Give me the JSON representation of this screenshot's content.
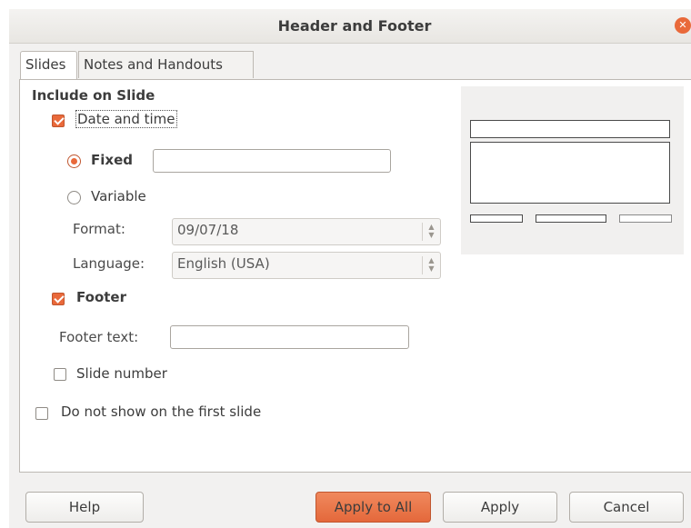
{
  "window": {
    "title": "Header and Footer"
  },
  "tabs": [
    {
      "label": "Slides",
      "active": true
    },
    {
      "label": "Notes and Handouts",
      "active": false
    }
  ],
  "include_section": {
    "heading": "Include on Slide"
  },
  "date_time": {
    "label": "Date and time",
    "checked": true
  },
  "fixed": {
    "label": "Fixed",
    "selected": true,
    "value": ""
  },
  "variable": {
    "label": "Variable",
    "selected": false
  },
  "format": {
    "label": "Format:",
    "value": "09/07/18"
  },
  "language": {
    "label": "Language:",
    "value": "English (USA)"
  },
  "footer": {
    "label": "Footer",
    "checked": true
  },
  "footer_text": {
    "label": "Footer text:",
    "value": ""
  },
  "slide_number": {
    "label": "Slide number",
    "checked": false
  },
  "first_slide": {
    "label": "Do not show on the first slide",
    "checked": false
  },
  "buttons": {
    "help": "Help",
    "apply_all": "Apply to All",
    "apply": "Apply",
    "cancel": "Cancel"
  },
  "colors": {
    "accent": "#e9693a",
    "dialog_bg": "#f2f1f0"
  },
  "icons": {
    "close": "close-icon"
  }
}
